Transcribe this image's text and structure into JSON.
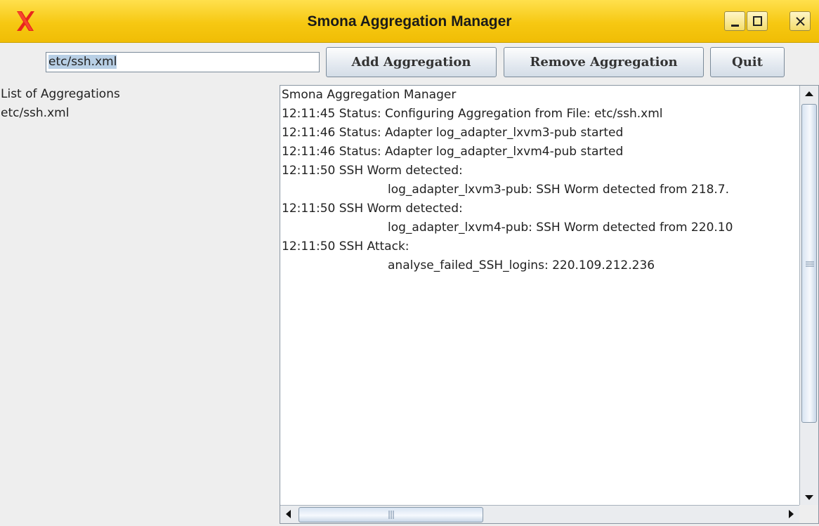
{
  "window": {
    "title": "Smona Aggregation Manager"
  },
  "toolbar": {
    "path_value": "etc/ssh.xml",
    "add_label": "Add Aggregation",
    "remove_label": "Remove Aggregation",
    "quit_label": "Quit"
  },
  "aggregations": {
    "header": "List of Aggregations",
    "items": [
      "etc/ssh.xml"
    ]
  },
  "log": {
    "lines": [
      "Smona Aggregation Manager",
      "12:11:45 Status: Configuring Aggregation from File: etc/ssh.xml",
      "12:11:46 Status: Adapter log_adapter_lxvm3-pub started",
      "12:11:46 Status: Adapter log_adapter_lxvm4-pub started",
      "12:11:50 SSH Worm detected:",
      "log_adapter_lxvm3-pub: SSH Worm detected from 218.7.",
      "12:11:50 SSH Worm detected:",
      "log_adapter_lxvm4-pub: SSH Worm detected from 220.10",
      "12:11:50 SSH Attack:",
      "analyse_failed_SSH_logins: 220.109.212.236"
    ]
  },
  "colors": {
    "titlebar": "#f6c812",
    "app_icon": "#e8261c",
    "selection": "#b8cfe5"
  },
  "icons": {
    "app": "x-logo-icon",
    "minimize": "minimize-icon",
    "maximize": "maximize-icon",
    "close": "close-icon"
  }
}
